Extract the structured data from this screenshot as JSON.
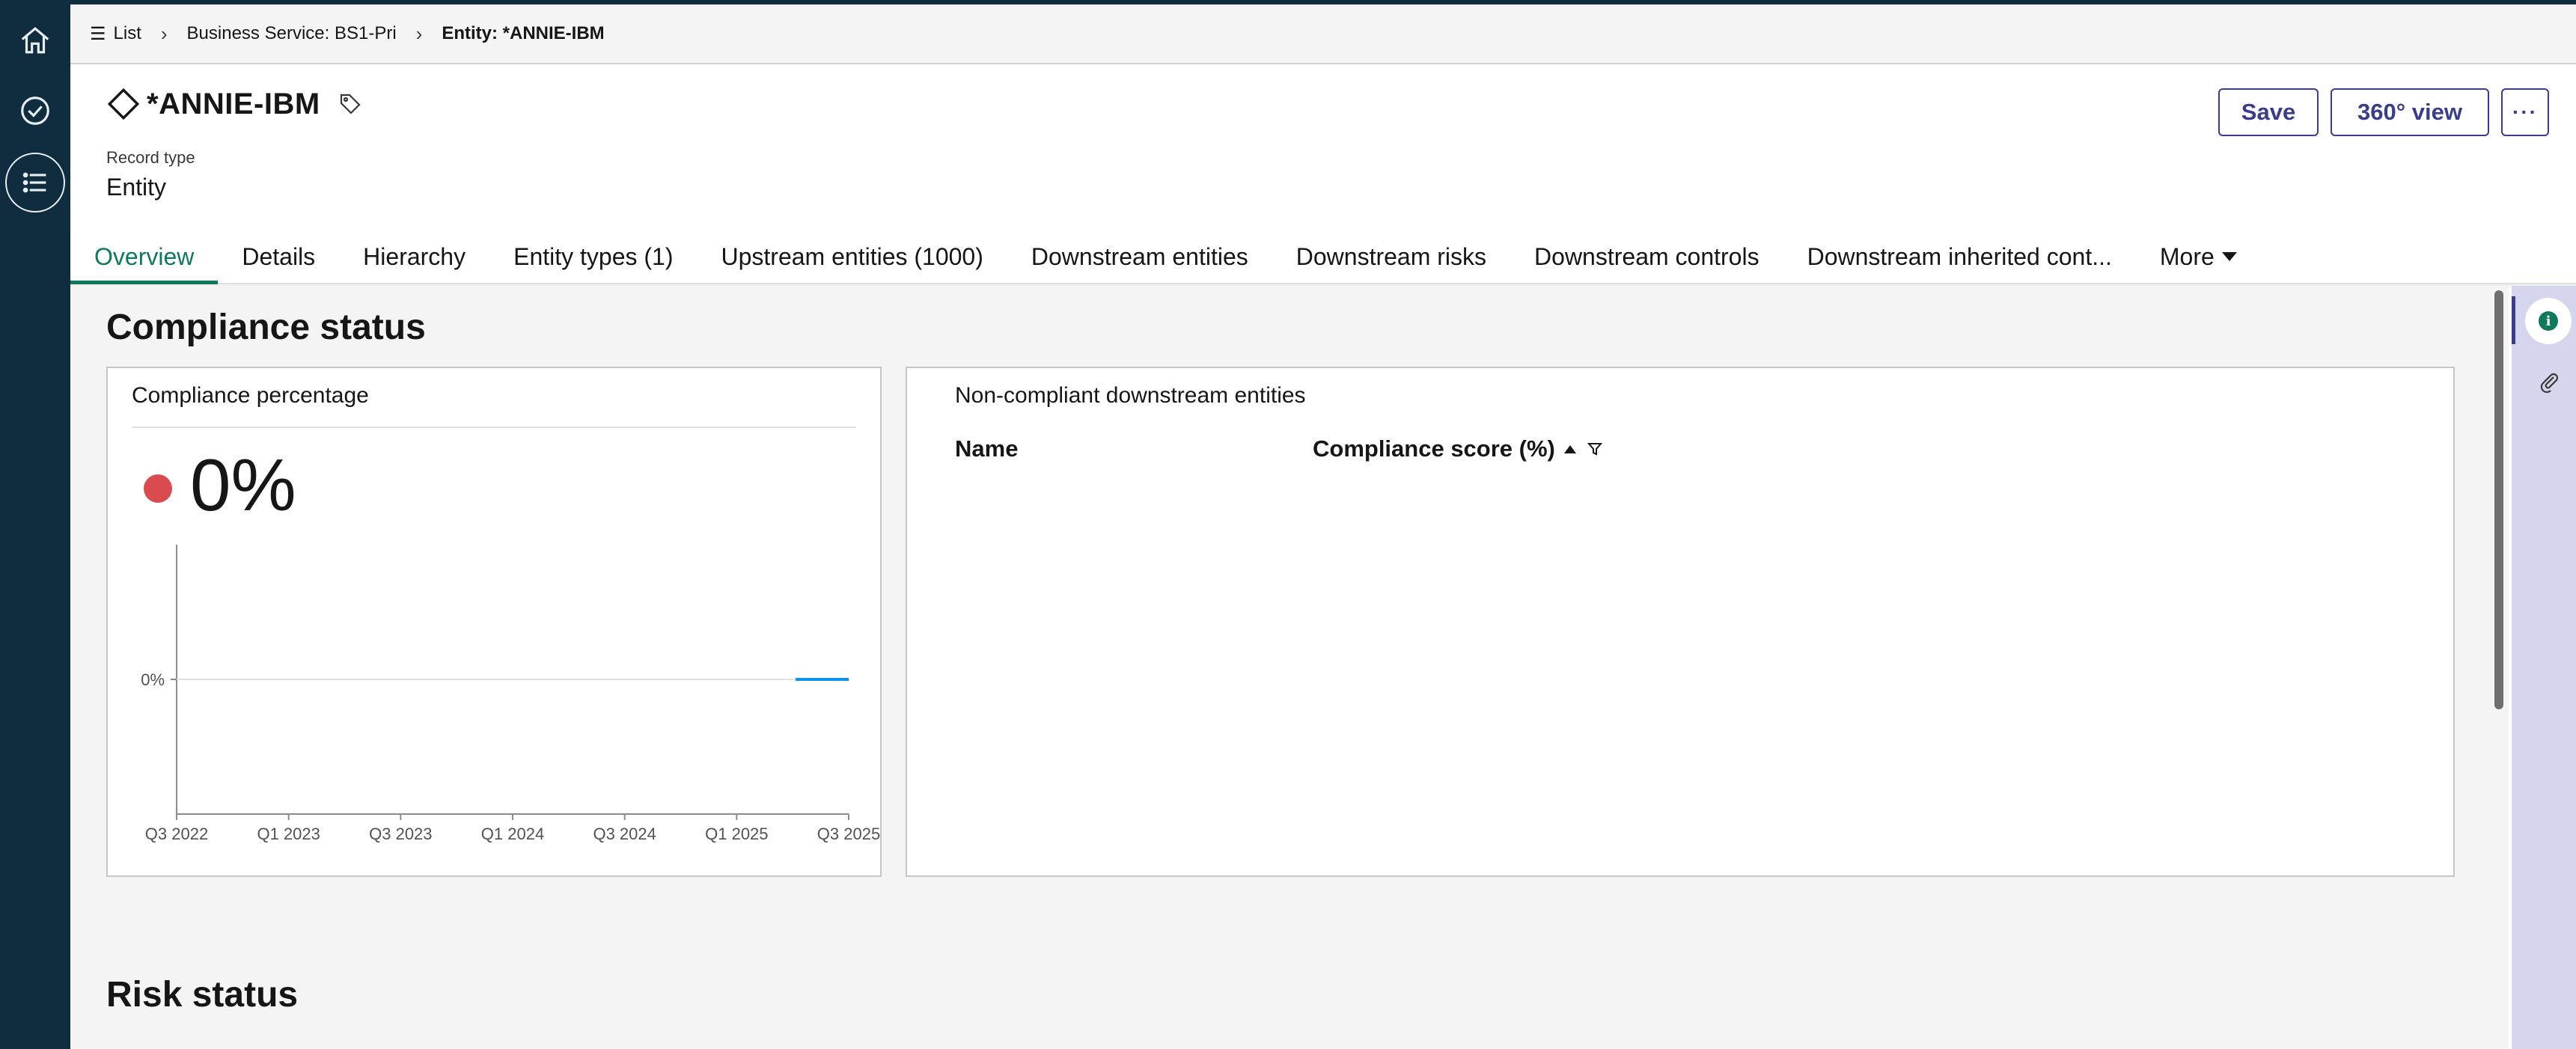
{
  "breadcrumb": {
    "items": [
      {
        "label": "List"
      },
      {
        "label": "Business Service: BS1-Pri"
      },
      {
        "label": "Entity: *ANNIE-IBM"
      }
    ]
  },
  "header": {
    "title": "*ANNIE-IBM",
    "record_type_label": "Record type",
    "record_type_value": "Entity",
    "save_label": "Save",
    "view360_label": "360° view",
    "more_label": "···"
  },
  "tabs": [
    {
      "label": "Overview",
      "active": true
    },
    {
      "label": "Details"
    },
    {
      "label": "Hierarchy"
    },
    {
      "label": "Entity types (1)"
    },
    {
      "label": "Upstream entities (1000)"
    },
    {
      "label": "Downstream entities"
    },
    {
      "label": "Downstream risks"
    },
    {
      "label": "Downstream controls"
    },
    {
      "label": "Downstream inherited cont..."
    },
    {
      "label": "More"
    }
  ],
  "compliance": {
    "section_title": "Compliance status",
    "percentage_card_title": "Compliance percentage",
    "percentage_value": "0%",
    "status_color": "#da4b4f",
    "noncompliant_card_title": "Non-compliant downstream entities",
    "columns": [
      "Name",
      "Compliance score (%)"
    ]
  },
  "risk": {
    "section_title": "Risk status"
  },
  "chart_data": {
    "type": "line",
    "x": [
      "2025-06",
      "2025-09"
    ],
    "series": [
      {
        "values": [
          0,
          0
        ],
        "color": "#1192e8"
      }
    ],
    "y_ticks": [
      "0%"
    ],
    "x_ticks": [
      "Q3 2022",
      "Q1 2023",
      "Q3 2023",
      "Q1 2024",
      "Q3 2024",
      "Q1 2025",
      "Q3 2025"
    ],
    "xlim": [
      "2022-07",
      "2025-09"
    ],
    "ylim": [
      0,
      0
    ],
    "grid": true
  },
  "colors": {
    "accent": "#0e7a5b",
    "primary_button": "#393d8a",
    "rail": "#0f2d3f"
  },
  "icons": {
    "rail": [
      "home-icon",
      "checkmark-circle-icon",
      "list-icon"
    ],
    "side": [
      "info-icon",
      "attachment-icon"
    ]
  }
}
